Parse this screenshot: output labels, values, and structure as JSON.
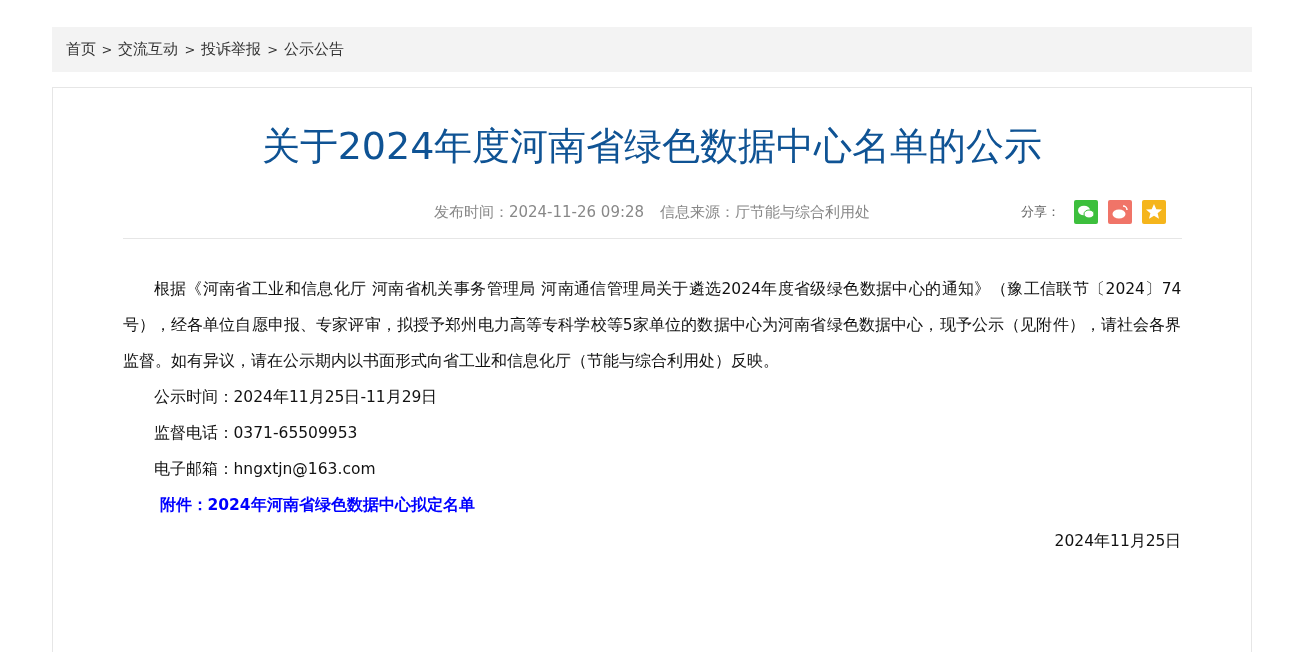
{
  "breadcrumb": {
    "items": [
      "首页",
      "交流互动",
      "投诉举报",
      "公示公告"
    ],
    "separators": [
      ">",
      ">",
      ">"
    ]
  },
  "article": {
    "title": "关于2024年度河南省绿色数据中心名单的公示",
    "meta": {
      "published": "发布时间：2024-11-26 09:28",
      "source": "信息来源：厅节能与综合利用处"
    },
    "share": {
      "label": "分享：",
      "buttons": [
        {
          "kind": "wechat"
        },
        {
          "kind": "weibo"
        },
        {
          "kind": "favorite"
        }
      ]
    },
    "paragraphs": [
      {
        "kind": "body",
        "text": "根据《河南省工业和信息化厅 河南省机关事务管理局 河南通信管理局关于遴选2024年度省级绿色数据中心的通知》（豫工信联节〔2024〕74号），经各单位自愿申报、专家评审，拟授予郑州电力高等专科学校等5家单位的数据中心为河南省绿色数据中心，现予公示（见附件），请社会各界监督。如有异议，请在公示期内以书面形式向省工业和信息化厅（节能与综合利用处）反映。"
      },
      {
        "kind": "body",
        "text": "公示时间：2024年11月25日-11月29日"
      },
      {
        "kind": "body",
        "text": "监督电话：0371-65509953"
      },
      {
        "kind": "body",
        "text": "电子邮箱：hngxtjn@163.com"
      },
      {
        "kind": "attachment",
        "text": "附件：2024年河南省绿色数据中心拟定名单"
      },
      {
        "kind": "date",
        "text": "2024年11月25日"
      }
    ]
  }
}
